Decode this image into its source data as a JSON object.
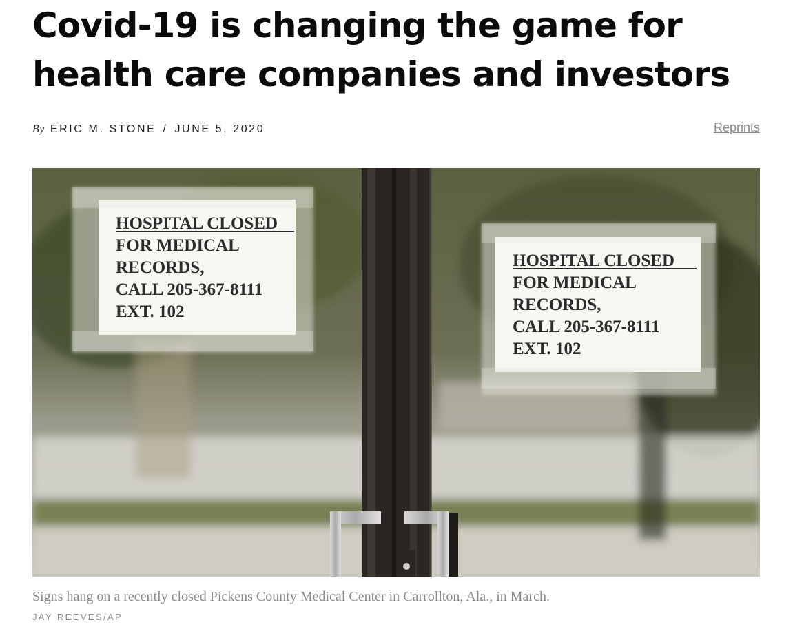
{
  "article": {
    "headline": "Covid-19 is changing the game for health care companies and investors",
    "byline": {
      "by": "By",
      "author": "ERIC M. STONE",
      "separator": "/",
      "date": "JUNE 5, 2020"
    },
    "reprints_label": "Reprints",
    "photo": {
      "signs": [
        {
          "title": "HOSPITAL CLOSED",
          "lines": [
            "FOR MEDICAL",
            "RECORDS,",
            "CALL 205-367-8111",
            "EXT. 102"
          ]
        },
        {
          "title": "HOSPITAL CLOSED",
          "lines": [
            "FOR MEDICAL",
            "RECORDS,",
            "CALL 205-367-8111",
            "EXT. 102"
          ]
        }
      ]
    },
    "caption": "Signs hang on a recently closed Pickens County Medical Center in Carrollton, Ala., in March.",
    "credit": "JAY REEVES/AP"
  }
}
